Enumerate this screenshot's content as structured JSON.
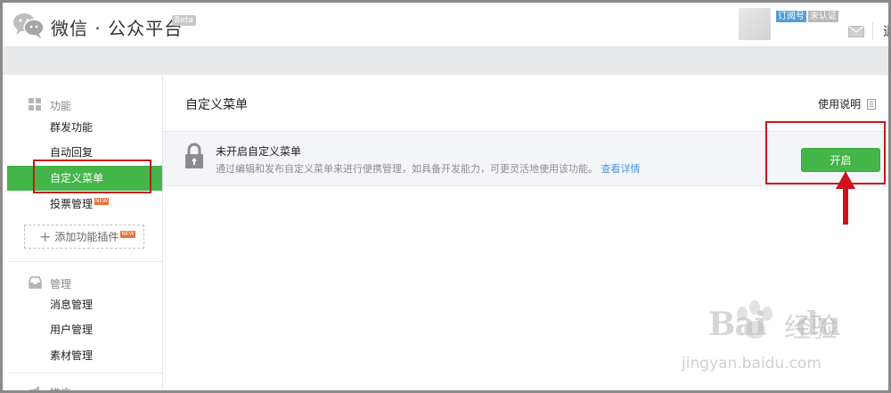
{
  "header": {
    "brand": "微信 · 公众平台",
    "beta": "Beta",
    "account_type_badge": "订阅号",
    "verify_badge": "未认证",
    "logout_partial": "退"
  },
  "sidebar": {
    "sections": [
      {
        "title": "功能",
        "icon": "grid-icon",
        "items": [
          {
            "label": "群发功能"
          },
          {
            "label": "自动回复"
          },
          {
            "label": "自定义菜单",
            "active": true
          },
          {
            "label": "投票管理",
            "badge": "NEW"
          }
        ],
        "add_plugin": {
          "label": "添加功能插件",
          "badge": "NEW"
        }
      },
      {
        "title": "管理",
        "icon": "inbox-icon",
        "items": [
          {
            "label": "消息管理"
          },
          {
            "label": "用户管理"
          },
          {
            "label": "素材管理"
          }
        ]
      },
      {
        "title": "推广",
        "icon": "megaphone-icon"
      }
    ]
  },
  "main": {
    "title": "自定义菜单",
    "help_link": "使用说明",
    "notice": {
      "title": "未开启自定义菜单",
      "description": "通过编辑和发布自定义菜单来进行便携管理，如具备开发能力，可更灵活地使用该功能。",
      "link": "查看详情"
    },
    "enable_button": "开启"
  },
  "watermark": {
    "brand": "Bai",
    "brand2": "du",
    "cn": "经验",
    "url": "jingyan.baidu.com"
  },
  "colors": {
    "accent_green": "#44b549",
    "annotation_red": "#c8161d",
    "link_blue": "#459ae9"
  }
}
